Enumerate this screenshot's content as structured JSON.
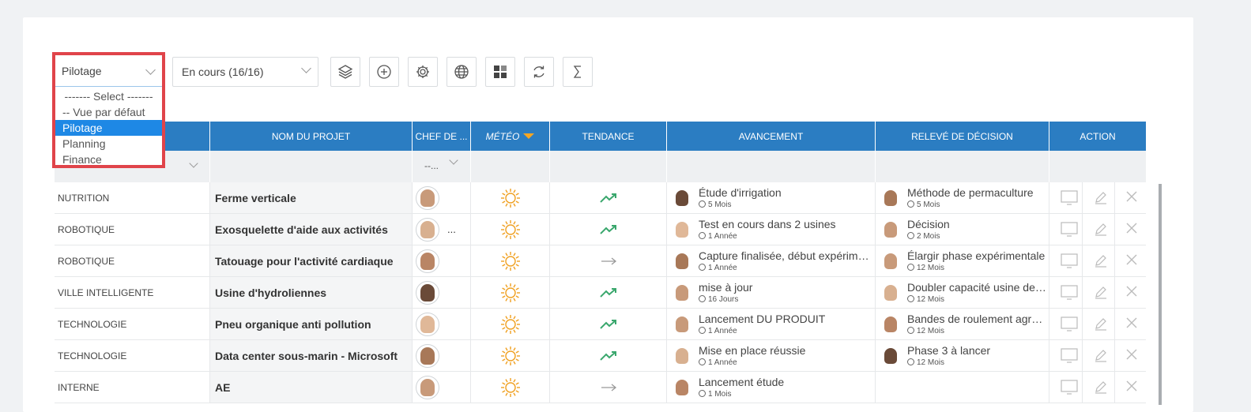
{
  "toolbar": {
    "view_select": "Pilotage",
    "status_select": "En cours (16/16)",
    "buttons": [
      "layers-icon",
      "plus-icon",
      "settings-icon",
      "globe-icon",
      "grid-icon",
      "refresh-icon",
      "sum-icon"
    ]
  },
  "dropdown": {
    "current": "Pilotage",
    "options": [
      {
        "label": "------- Select -------"
      },
      {
        "label": "-- Vue par défaut"
      },
      {
        "label": "Pilotage"
      },
      {
        "label": "Planning"
      },
      {
        "label": "Finance"
      }
    ]
  },
  "headers": {
    "project": "NOM DU PROJET",
    "chef": "CHEF DE ...",
    "meteo": "MÉTÉO",
    "tendance": "TENDANCE",
    "avancement": "AVANCEMENT",
    "releve": "RELEVÉ DE DÉCISION",
    "action": "ACTION"
  },
  "filter": {
    "chef": "--..."
  },
  "rows": [
    {
      "category": "NUTRITION",
      "project": "Ferme verticale",
      "extra": "",
      "trend": "up",
      "av_title": "Étude d'irrigation",
      "av_age": "5 Mois",
      "rd_title": "Méthode de permaculture",
      "rd_age": "5 Mois"
    },
    {
      "category": "ROBOTIQUE",
      "project": "Exosquelette d'aide aux activités",
      "extra": "...",
      "trend": "up",
      "av_title": "Test en cours dans 2 usines",
      "av_age": "1 Année",
      "rd_title": "Décision",
      "rd_age": "2 Mois"
    },
    {
      "category": "ROBOTIQUE",
      "project": "Tatouage pour l'activité cardiaque",
      "extra": "",
      "trend": "flat",
      "av_title": "Capture finalisée, début expérimentation",
      "av_age": "1 Année",
      "rd_title": "Élargir phase expérimentale",
      "rd_age": "12 Mois"
    },
    {
      "category": "VILLE INTELLIGENTE",
      "project": "Usine d'hydroliennes",
      "extra": "",
      "trend": "up",
      "av_title": "mise à jour",
      "av_age": "16 Jours",
      "rd_title": "Doubler capacité usine de production",
      "rd_age": "12 Mois"
    },
    {
      "category": "TECHNOLOGIE",
      "project": "Pneu organique anti pollution",
      "extra": "",
      "trend": "up",
      "av_title": "Lancement DU PRODUIT",
      "av_age": "1 Année",
      "rd_title": "Bandes de roulement agrées",
      "rd_age": "12 Mois"
    },
    {
      "category": "TECHNOLOGIE",
      "project": "Data center sous-marin - Microsoft",
      "extra": "",
      "trend": "up",
      "av_title": "Mise en place réussie",
      "av_age": "1 Année",
      "rd_title": "Phase 3 à lancer",
      "rd_age": "12 Mois"
    },
    {
      "category": "INTERNE",
      "project": "AE",
      "extra": "",
      "trend": "flat",
      "av_title": "Lancement étude",
      "av_age": "1 Mois",
      "rd_title": "",
      "rd_age": ""
    }
  ],
  "colors": {
    "header": "#2b7dc2",
    "sun": "#f0a020",
    "trend_up": "#3aa76d",
    "trend_flat": "#999999",
    "highlight": "#e0444a",
    "selected": "#1e88e5"
  }
}
